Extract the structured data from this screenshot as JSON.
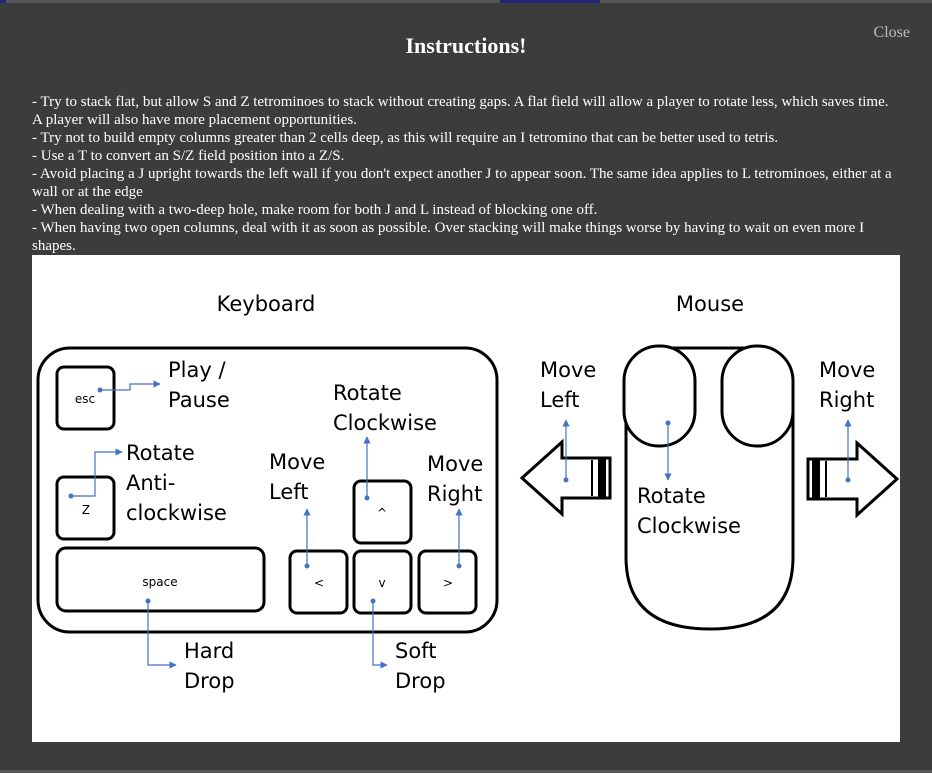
{
  "dialog": {
    "title": "Instructions!",
    "close_label": "Close",
    "tips": [
      "- Try to stack flat, but allow S and Z tetrominoes to stack without creating gaps. A flat field will allow a player to rotate less, which saves time. A player will also have more placement opportunities.",
      "- Try not to build empty columns greater than 2 cells deep, as this will require an I tetromino that can be better used to tetris.",
      "- Use a T to convert an S/Z field position into a Z/S.",
      "- Avoid placing a J upright towards the left wall if you don't expect another J to appear soon. The same idea applies to L tetrominoes, either at a wall or at the edge",
      "- When dealing with a two-deep hole, make room for both J and L instead of blocking one off.",
      "- When having two open columns, deal with it as soon as possible. Over stacking will make things worse by having to wait on even more I shapes."
    ]
  },
  "diagram": {
    "keyboard_heading": "Keyboard",
    "mouse_heading": "Mouse",
    "keys": {
      "esc": "esc",
      "z": "Z",
      "space": "space",
      "left": "<",
      "down": "v",
      "up": "^",
      "right": ">"
    },
    "keyboard_labels": {
      "play_pause": [
        "Play /",
        "Pause"
      ],
      "rotate_anti": [
        "Rotate",
        "Anti-",
        "clockwise"
      ],
      "rotate_cw": [
        "Rotate",
        "Clockwise"
      ],
      "move_left": [
        "Move",
        "Left"
      ],
      "move_right": [
        "Move",
        "Right"
      ],
      "hard_drop": [
        "Hard",
        "Drop"
      ],
      "soft_drop": [
        "Soft",
        "Drop"
      ]
    },
    "mouse_labels": {
      "move_left": [
        "Move",
        "Left"
      ],
      "move_right": [
        "Move",
        "Right"
      ],
      "rotate_cw": [
        "Rotate",
        "Clockwise"
      ]
    },
    "accent_color": "#4472c4"
  }
}
